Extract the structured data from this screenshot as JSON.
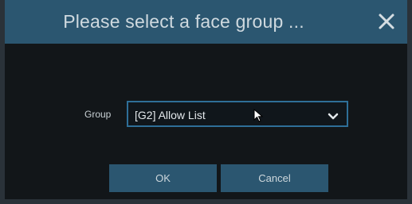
{
  "dialog": {
    "title": "Please select a face group ...",
    "close_icon": "close-icon"
  },
  "form": {
    "group_label": "Group",
    "group_selected": "[G2] Allow List",
    "chevron_icon": "chevron-down-icon"
  },
  "buttons": {
    "ok_label": "OK",
    "cancel_label": "Cancel"
  },
  "colors": {
    "titlebar": "#2b5670",
    "background": "#121619",
    "button": "#2b5670",
    "select_border": "#2e6f98"
  }
}
